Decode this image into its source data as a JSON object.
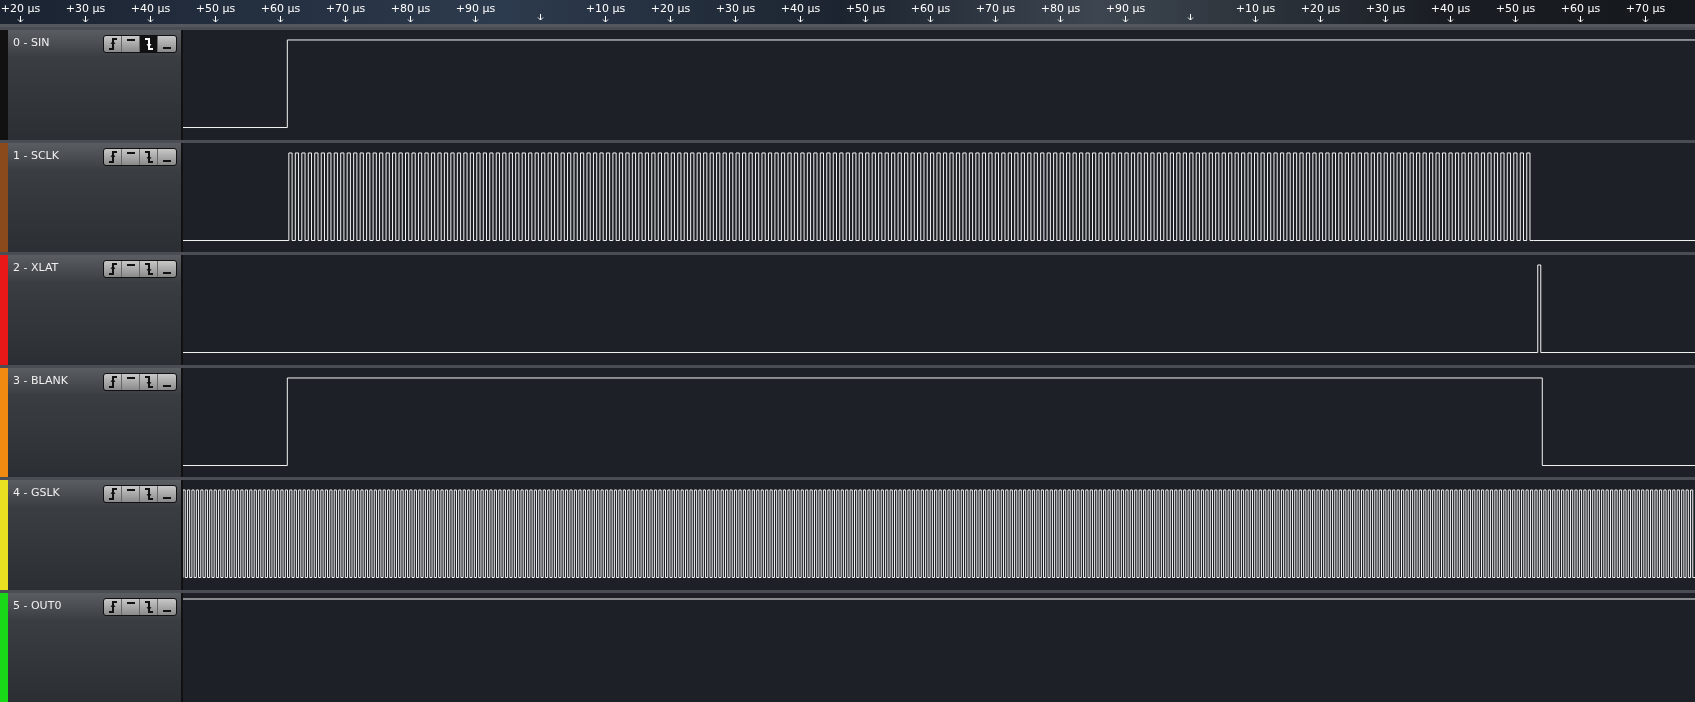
{
  "ruler": {
    "ticks": [
      {
        "kind": "label",
        "label": "+20 µs"
      },
      {
        "kind": "label",
        "label": "+30 µs"
      },
      {
        "kind": "label",
        "label": "+40 µs"
      },
      {
        "kind": "label",
        "label": "+50 µs"
      },
      {
        "kind": "label",
        "label": "+60 µs"
      },
      {
        "kind": "label",
        "label": "+70 µs"
      },
      {
        "kind": "label",
        "label": "+80 µs"
      },
      {
        "kind": "label",
        "label": "+90 µs"
      },
      {
        "kind": "marker"
      },
      {
        "kind": "label",
        "label": "+10 µs"
      },
      {
        "kind": "label",
        "label": "+20 µs"
      },
      {
        "kind": "label",
        "label": "+30 µs"
      },
      {
        "kind": "label",
        "label": "+40 µs"
      },
      {
        "kind": "label",
        "label": "+50 µs"
      },
      {
        "kind": "label",
        "label": "+60 µs"
      },
      {
        "kind": "label",
        "label": "+70 µs"
      },
      {
        "kind": "label",
        "label": "+80 µs"
      },
      {
        "kind": "label",
        "label": "+90 µs"
      },
      {
        "kind": "marker"
      },
      {
        "kind": "label",
        "label": "+10 µs"
      },
      {
        "kind": "label",
        "label": "+20 µs"
      },
      {
        "kind": "label",
        "label": "+30 µs"
      },
      {
        "kind": "label",
        "label": "+40 µs"
      },
      {
        "kind": "label",
        "label": "+50 µs"
      },
      {
        "kind": "label",
        "label": "+60 µs"
      },
      {
        "kind": "label",
        "label": "+70 µs"
      }
    ]
  },
  "channels": [
    {
      "name": "0 - SIN",
      "color": "#111111",
      "kind": "step-up",
      "triggers": [
        {
          "kind": "rising",
          "selected": false
        },
        {
          "kind": "high",
          "selected": false
        },
        {
          "kind": "falling",
          "selected": true
        },
        {
          "kind": "low",
          "selected": false
        }
      ]
    },
    {
      "name": "1 - SCLK",
      "color": "#8a4a1c",
      "kind": "clock-burst",
      "triggers": [
        {
          "kind": "rising",
          "selected": false
        },
        {
          "kind": "high",
          "selected": false
        },
        {
          "kind": "falling",
          "selected": false
        },
        {
          "kind": "low",
          "selected": false
        }
      ]
    },
    {
      "name": "2 - XLAT",
      "color": "#e81818",
      "kind": "pulse",
      "triggers": [
        {
          "kind": "rising",
          "selected": false
        },
        {
          "kind": "high",
          "selected": false
        },
        {
          "kind": "falling",
          "selected": false
        },
        {
          "kind": "low",
          "selected": false
        }
      ]
    },
    {
      "name": "3 - BLANK",
      "color": "#f08a10",
      "kind": "window",
      "triggers": [
        {
          "kind": "rising",
          "selected": false
        },
        {
          "kind": "high",
          "selected": false
        },
        {
          "kind": "falling",
          "selected": false
        },
        {
          "kind": "low",
          "selected": false
        }
      ]
    },
    {
      "name": "4 - GSLK",
      "color": "#e8e020",
      "kind": "clock",
      "triggers": [
        {
          "kind": "rising",
          "selected": false
        },
        {
          "kind": "high",
          "selected": false
        },
        {
          "kind": "falling",
          "selected": false
        },
        {
          "kind": "low",
          "selected": false
        }
      ]
    },
    {
      "name": "5 - OUT0",
      "color": "#18d818",
      "kind": "high",
      "triggers": [
        {
          "kind": "rising",
          "selected": false
        },
        {
          "kind": "high",
          "selected": false
        },
        {
          "kind": "falling",
          "selected": false
        },
        {
          "kind": "low",
          "selected": false
        }
      ]
    }
  ]
}
